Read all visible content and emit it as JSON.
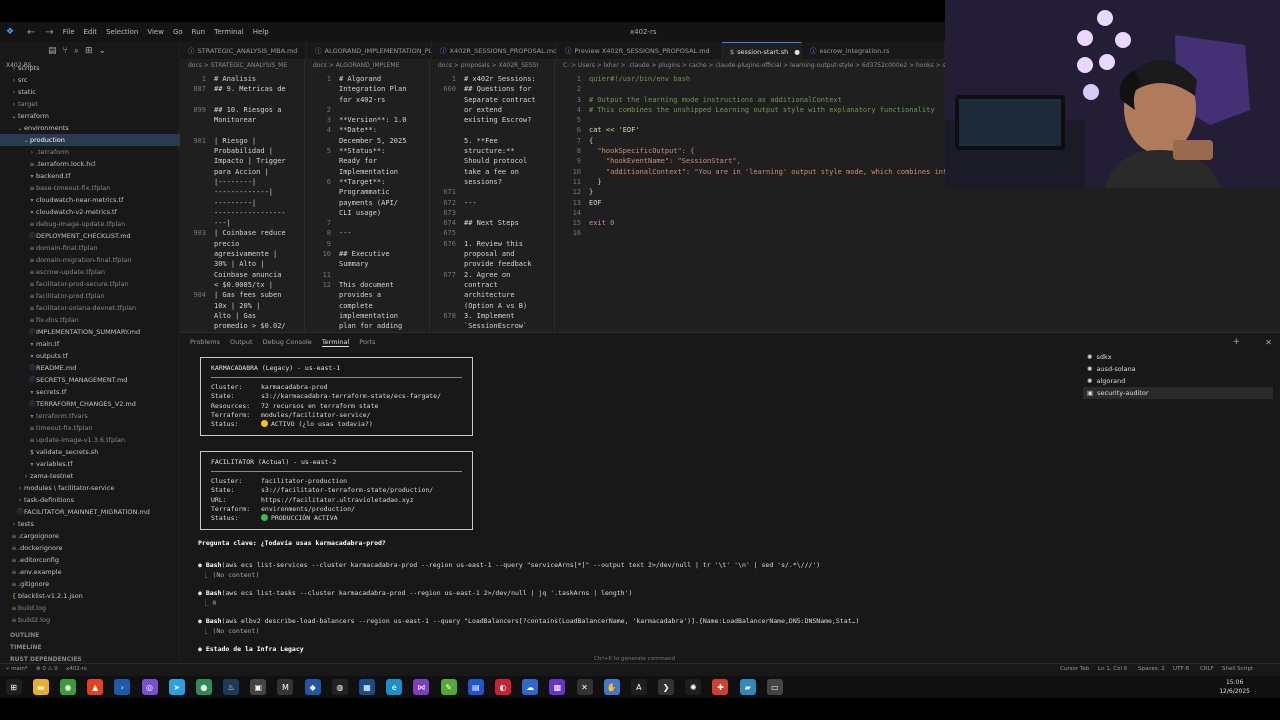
{
  "window": {
    "title": "x402-rs",
    "menus": [
      "File",
      "Edit",
      "Selection",
      "View",
      "Go",
      "Run",
      "Terminal",
      "Help"
    ]
  },
  "explorer": {
    "root": "X402-RS",
    "items": [
      {
        "label": "scripts",
        "depth": 1,
        "kind": "folder",
        "color": "#c5c5c5"
      },
      {
        "label": "src",
        "depth": 1,
        "kind": "folder",
        "color": "#c5c5c5"
      },
      {
        "label": "static",
        "depth": 1,
        "kind": "folder",
        "color": "#c5c5c5"
      },
      {
        "label": "target",
        "depth": 1,
        "kind": "folder",
        "color": "#8a8a8a"
      },
      {
        "label": "terraform",
        "depth": 1,
        "kind": "folder-open",
        "color": "#c5c5c5"
      },
      {
        "label": "environments",
        "depth": 2,
        "kind": "folder-open",
        "color": "#c5c5c5"
      },
      {
        "label": "production",
        "depth": 3,
        "kind": "folder-open",
        "color": "#ffffff",
        "selected": true
      },
      {
        "label": ".terraform",
        "depth": 4,
        "kind": "folder",
        "color": "#8a8a8a"
      },
      {
        "label": ".terraform.lock.hcl",
        "depth": 4,
        "kind": "file",
        "color": "#c5c5c5"
      },
      {
        "label": "backend.tf",
        "depth": 4,
        "kind": "tf",
        "color": "#c5c5c5"
      },
      {
        "label": "base-timeout-fix.tfplan",
        "depth": 4,
        "kind": "file",
        "color": "#8a8a8a"
      },
      {
        "label": "cloudwatch-near-metrics.tf",
        "depth": 4,
        "kind": "tf",
        "color": "#c5c5c5"
      },
      {
        "label": "cloudwatch-v2-metrics.tf",
        "depth": 4,
        "kind": "tf",
        "color": "#c5c5c5"
      },
      {
        "label": "debug-image-update.tfplan",
        "depth": 4,
        "kind": "file",
        "color": "#8a8a8a"
      },
      {
        "label": "DEPLOYMENT_CHECKLIST.md",
        "depth": 4,
        "kind": "md",
        "color": "#c5c5c5"
      },
      {
        "label": "domain-final.tfplan",
        "depth": 4,
        "kind": "file",
        "color": "#8a8a8a"
      },
      {
        "label": "domain-migration-final.tfplan",
        "depth": 4,
        "kind": "file",
        "color": "#8a8a8a"
      },
      {
        "label": "escrow-update.tfplan",
        "depth": 4,
        "kind": "file",
        "color": "#8a8a8a"
      },
      {
        "label": "facilitator-prod-secure.tfplan",
        "depth": 4,
        "kind": "file",
        "color": "#8a8a8a"
      },
      {
        "label": "facilitator-prod.tfplan",
        "depth": 4,
        "kind": "file",
        "color": "#8a8a8a"
      },
      {
        "label": "facilitator-solana-devnet.tfplan",
        "depth": 4,
        "kind": "file",
        "color": "#8a8a8a"
      },
      {
        "label": "fix-dns.tfplan",
        "depth": 4,
        "kind": "file",
        "color": "#8a8a8a"
      },
      {
        "label": "IMPLEMENTATION_SUMMARY.md",
        "depth": 4,
        "kind": "md",
        "color": "#c5c5c5"
      },
      {
        "label": "main.tf",
        "depth": 4,
        "kind": "tf",
        "color": "#c5c5c5"
      },
      {
        "label": "outputs.tf",
        "depth": 4,
        "kind": "tf",
        "color": "#c5c5c5"
      },
      {
        "label": "README.md",
        "depth": 4,
        "kind": "md",
        "color": "#c5c5c5"
      },
      {
        "label": "SECRETS_MANAGEMENT.md",
        "depth": 4,
        "kind": "md",
        "color": "#c5c5c5"
      },
      {
        "label": "secrets.tf",
        "depth": 4,
        "kind": "tf",
        "color": "#c5c5c5"
      },
      {
        "label": "TERRAFORM_CHANGES_V2.md",
        "depth": 4,
        "kind": "md",
        "color": "#c5c5c5"
      },
      {
        "label": "terraform.tfvars",
        "depth": 4,
        "kind": "tf",
        "color": "#8a8a8a"
      },
      {
        "label": "timeout-fix.tfplan",
        "depth": 4,
        "kind": "file",
        "color": "#8a8a8a"
      },
      {
        "label": "update-image-v1.3.6.tfplan",
        "depth": 4,
        "kind": "file",
        "color": "#8a8a8a"
      },
      {
        "label": "validate_secrets.sh",
        "depth": 4,
        "kind": "sh",
        "color": "#c5c5c5"
      },
      {
        "label": "variables.tf",
        "depth": 4,
        "kind": "tf",
        "color": "#c5c5c5"
      },
      {
        "label": "zama-testnet",
        "depth": 3,
        "kind": "folder",
        "color": "#c5c5c5"
      },
      {
        "label": "modules \\ facilitator-service",
        "depth": 2,
        "kind": "folder",
        "color": "#c5c5c5"
      },
      {
        "label": "task-definitions",
        "depth": 2,
        "kind": "folder",
        "color": "#c5c5c5"
      },
      {
        "label": "FACILITATOR_MAINNET_MIGRATION.md",
        "depth": 2,
        "kind": "md",
        "color": "#c5c5c5"
      },
      {
        "label": "tests",
        "depth": 1,
        "kind": "folder",
        "color": "#c5c5c5"
      },
      {
        "label": ".cargoignore",
        "depth": 1,
        "kind": "file",
        "color": "#c5c5c5"
      },
      {
        "label": ".dockerignore",
        "depth": 1,
        "kind": "file",
        "color": "#c5c5c5"
      },
      {
        "label": ".editorconfig",
        "depth": 1,
        "kind": "file",
        "color": "#c5c5c5"
      },
      {
        "label": ".env.example",
        "depth": 1,
        "kind": "file",
        "color": "#c5c5c5"
      },
      {
        "label": ".gitignore",
        "depth": 1,
        "kind": "file",
        "color": "#c5c5c5"
      },
      {
        "label": "blacklist-v1.2.1.json",
        "depth": 1,
        "kind": "json",
        "color": "#c5c5c5"
      },
      {
        "label": "build.log",
        "depth": 1,
        "kind": "file",
        "color": "#8a8a8a"
      },
      {
        "label": "build2.log",
        "depth": 1,
        "kind": "file",
        "color": "#8a8a8a"
      }
    ],
    "sections": [
      "OUTLINE",
      "TIMELINE",
      "RUST DEPENDENCIES"
    ]
  },
  "tabs": [
    {
      "label": "STRATEGIC_ANALYSIS_MBA.md",
      "w": 127
    },
    {
      "label": "ALGORAND_IMPLEMENTATION_PLAN.md",
      "w": 125
    },
    {
      "label": "X402R_SESSIONS_PROPOSAL.md",
      "w": 125
    },
    {
      "label": "Preview X402R_SESSIONS_PROPOSAL.md",
      "w": 165
    },
    {
      "label": "session-start.sh",
      "w": 80,
      "active": true
    },
    {
      "label": "escrow_integration.rs",
      "w": 143
    }
  ],
  "panes": [
    {
      "crumb": "docs > STRATEGIC_ANALYSIS_ME",
      "lines": [
        {
          "n": "1",
          "t": "# Analisis"
        },
        {
          "n": "887",
          "t": "## 9. Metricas de"
        },
        {
          "n": "",
          "t": ""
        },
        {
          "n": "899",
          "t": "## 10. Riesgos a"
        },
        {
          "n": "",
          "t": "Monitorear"
        },
        {
          "n": "",
          "t": ""
        },
        {
          "n": "901",
          "t": "| Riesgo |"
        },
        {
          "n": "",
          "t": "Probabilidad |"
        },
        {
          "n": "",
          "t": "Impacto | Trigger"
        },
        {
          "n": "",
          "t": "para Accion |"
        },
        {
          "n": "",
          "t": "|--------|"
        },
        {
          "n": "",
          "t": "-------------|"
        },
        {
          "n": "",
          "t": "---------|"
        },
        {
          "n": "",
          "t": "-----------------"
        },
        {
          "n": "",
          "t": "---|"
        },
        {
          "n": "903",
          "t": "| Coinbase reduce"
        },
        {
          "n": "",
          "t": "precio"
        },
        {
          "n": "",
          "t": "agresivamente |"
        },
        {
          "n": "",
          "t": "30% | Alto |"
        },
        {
          "n": "",
          "t": "Coinbase anuncia"
        },
        {
          "n": "",
          "t": "< $0.0005/tx |"
        },
        {
          "n": "904",
          "t": "| Gas fees suben"
        },
        {
          "n": "",
          "t": "10x | 20% |"
        },
        {
          "n": "",
          "t": "Alto | Gas"
        },
        {
          "n": "",
          "t": "promedio > $0.02/"
        }
      ]
    },
    {
      "crumb": "docs > ALGORAND_IMPLEME",
      "lines": [
        {
          "n": "1",
          "t": "# Algorand"
        },
        {
          "n": "",
          "t": "Integration Plan"
        },
        {
          "n": "",
          "t": "for x402-rs"
        },
        {
          "n": "2",
          "t": ""
        },
        {
          "n": "3",
          "t": "**Version**: 1.0"
        },
        {
          "n": "4",
          "t": "**Date**:"
        },
        {
          "n": "",
          "t": "December 5, 2025"
        },
        {
          "n": "5",
          "t": "**Status**:"
        },
        {
          "n": "",
          "t": "Ready for"
        },
        {
          "n": "",
          "t": "Implementation"
        },
        {
          "n": "6",
          "t": "**Target**:"
        },
        {
          "n": "",
          "t": "Programmatic"
        },
        {
          "n": "",
          "t": "payments (API/"
        },
        {
          "n": "",
          "t": "CLI usage)"
        },
        {
          "n": "7",
          "t": ""
        },
        {
          "n": "8",
          "t": "---"
        },
        {
          "n": "9",
          "t": ""
        },
        {
          "n": "10",
          "t": "## Executive"
        },
        {
          "n": "",
          "t": "Summary"
        },
        {
          "n": "11",
          "t": ""
        },
        {
          "n": "12",
          "t": "This document"
        },
        {
          "n": "",
          "t": "provides a"
        },
        {
          "n": "",
          "t": "complete"
        },
        {
          "n": "",
          "t": "implementation"
        },
        {
          "n": "",
          "t": "plan for adding"
        }
      ]
    },
    {
      "crumb": "docs > proposals > X402R_SESSI",
      "lines": [
        {
          "n": "1",
          "t": "# x402r Sessions:"
        },
        {
          "n": "660",
          "t": "## Questions for"
        },
        {
          "n": "",
          "t": "Separate contract"
        },
        {
          "n": "",
          "t": "or extend"
        },
        {
          "n": "",
          "t": "existing Escrow?"
        },
        {
          "n": "",
          "t": ""
        },
        {
          "n": "",
          "t": "5. **Fee"
        },
        {
          "n": "",
          "t": "structure:**"
        },
        {
          "n": "",
          "t": "Should protocol"
        },
        {
          "n": "",
          "t": "take a fee on"
        },
        {
          "n": "",
          "t": "sessions?"
        },
        {
          "n": "671",
          "t": ""
        },
        {
          "n": "672",
          "t": "---"
        },
        {
          "n": "673",
          "t": ""
        },
        {
          "n": "674",
          "t": "## Next Steps"
        },
        {
          "n": "675",
          "t": ""
        },
        {
          "n": "676",
          "t": "1. Review this"
        },
        {
          "n": "",
          "t": "proposal and"
        },
        {
          "n": "",
          "t": "provide feedback"
        },
        {
          "n": "677",
          "t": "2. Agree on"
        },
        {
          "n": "",
          "t": "contract"
        },
        {
          "n": "",
          "t": "architecture"
        },
        {
          "n": "",
          "t": "(Option A vs B)"
        },
        {
          "n": "678",
          "t": "3. Implement"
        },
        {
          "n": "",
          "t": "`SessionEscrow`"
        }
      ]
    },
    {
      "crumb": "C: > Users > lxhxr > .claude > plugins > cache > claude-plugins-official > learning-output-style > 6d3752c000e2 > hooks > session-start.sh",
      "lines": [
        {
          "n": "1",
          "t": "quier#!/usr/bin/env bash",
          "c": "cm"
        },
        {
          "n": "2",
          "t": ""
        },
        {
          "n": "3",
          "t": "# Output the learning mode instructions as additionalContext",
          "c": "cm"
        },
        {
          "n": "4",
          "t": "# This combines the unshipped Learning output style with explanatory functionality",
          "c": "cm"
        },
        {
          "n": "5",
          "t": ""
        },
        {
          "n": "6",
          "t": "cat << 'EOF'",
          "c": "fn"
        },
        {
          "n": "7",
          "t": "{",
          "c": "t"
        },
        {
          "n": "8",
          "t": "  \"hookSpecificOutput\": {",
          "c": "st"
        },
        {
          "n": "9",
          "t": "    \"hookEventName\": \"SessionStart\",",
          "c": "st"
        },
        {
          "n": "10",
          "t": "    \"additionalContext\": \"You are in 'learning' output style mode, which combines interactive",
          "c": "st"
        },
        {
          "n": "11",
          "t": "  }",
          "c": "t"
        },
        {
          "n": "12",
          "t": "}",
          "c": "t"
        },
        {
          "n": "13",
          "t": "EOF",
          "c": "t"
        },
        {
          "n": "14",
          "t": ""
        },
        {
          "n": "15",
          "t": "exit 0",
          "c": "kw"
        },
        {
          "n": "16",
          "t": ""
        }
      ]
    }
  ],
  "panel": {
    "tabs": [
      "Problems",
      "Output",
      "Debug Console",
      "Terminal",
      "Ports"
    ],
    "active_tab": "Terminal"
  },
  "terminal": {
    "box1": {
      "title": "KARMACADABRA (Legacy) - us-east-1",
      "rows": [
        {
          "k": "Cluster:",
          "v": "karmacadabra-prod"
        },
        {
          "k": "State:",
          "v": "s3://karmacadabra-terraform-state/ecs-fargate/"
        },
        {
          "k": "Resources:",
          "v": "72 recursos en terraform state"
        },
        {
          "k": "Terraform:",
          "v": "modules/facilitator-service/"
        },
        {
          "k": "Status:",
          "v": "ACTIVO (¿lo usas todavia?)",
          "dot": "#f2c811"
        }
      ]
    },
    "box2": {
      "title": "FACILITATOR (Actual) - us-east-2",
      "rows": [
        {
          "k": "Cluster:",
          "v": "facilitator-production"
        },
        {
          "k": "State:",
          "v": "s3://facilitator-terraform-state/production/"
        },
        {
          "k": "URL:",
          "v": "https://facilitator.ultravioletadao.xyz"
        },
        {
          "k": "Terraform:",
          "v": "environments/production/"
        },
        {
          "k": "Status:",
          "v": "PRODUCCIÓN ACTIVA",
          "dot": "#3fb950"
        }
      ]
    },
    "question": "Pregunta clave: ¿Todavía usas karmacadabra-prod?",
    "cmds": [
      {
        "tool": "Bash",
        "cmd": "(aws ecs list-services --cluster karmacadabra-prod --region us-east-1 --query \"serviceArns[*]\" --output text 2>/dev/null | tr '\\t' '\\n' | sed 's/.*\\///')",
        "out": "(No content)"
      },
      {
        "tool": "Bash",
        "cmd": "(aws ecs list-tasks --cluster karmacadabra-prod --region us-east-1 2>/dev/null | jq '.taskArns | length')",
        "out": "0"
      },
      {
        "tool": "Bash",
        "cmd": "(aws elbv2 describe-load-balancers --region us-east-1 --query \"LoadBalancers[?contains(LoadBalancerName, 'karmacadabra')].{Name:LoadBalancerName,DNS:DNSName,Stat…)",
        "out": "(No content)"
      }
    ],
    "last": "Estado de la Infra Legacy",
    "hint": "Ctrl+K to generate command"
  },
  "processes": [
    {
      "label": "sdkx"
    },
    {
      "label": "ausd-solana"
    },
    {
      "label": "algorand"
    },
    {
      "label": "security-auditor",
      "selected": true
    }
  ],
  "statusbar": {
    "branch": "main*",
    "errors": "⊗ 0 ⚠ 0",
    "workspace": "x402-rs",
    "right": [
      "Cursor Tab",
      "Ln 1, Col 6",
      "Spaces: 2",
      "UTF-8",
      "CRLF",
      "Shell Script"
    ]
  },
  "clock": {
    "time": "15:06",
    "date": "12/6/2025"
  },
  "taskbar": {
    "icons": [
      {
        "name": "windows-start-icon",
        "c": "#1e1e1e",
        "g": "⊞"
      },
      {
        "name": "file-explorer-icon",
        "c": "#e8b02a",
        "g": "▬"
      },
      {
        "name": "app-green-icon",
        "c": "#3c9a3c",
        "g": "◉"
      },
      {
        "name": "brave-icon",
        "c": "#e0431e",
        "g": "▲"
      },
      {
        "name": "terminal-icon",
        "c": "#1e5aa8",
        "g": "›"
      },
      {
        "name": "browser-icon",
        "c": "#7a4fd1",
        "g": "◎"
      },
      {
        "name": "telegram-icon",
        "c": "#2aa1e0",
        "g": "➤"
      },
      {
        "name": "chrome-icon",
        "c": "#2e8b57",
        "g": "●"
      },
      {
        "name": "steam-icon",
        "c": "#1b3a5c",
        "g": "♨"
      },
      {
        "name": "app-icon",
        "c": "#444",
        "g": "▣"
      },
      {
        "name": "app-m-icon",
        "c": "#333",
        "g": "M"
      },
      {
        "name": "app-blue-icon",
        "c": "#2255aa",
        "g": "◆"
      },
      {
        "name": "obs-icon",
        "c": "#222",
        "g": "◍"
      },
      {
        "name": "app-dark-icon",
        "c": "#1a4c8c",
        "g": "▦"
      },
      {
        "name": "edge-icon",
        "c": "#1a8fc9",
        "g": "e"
      },
      {
        "name": "vscode-icon",
        "c": "#7b3fc4",
        "g": "⋈"
      },
      {
        "name": "app-pen-icon",
        "c": "#55aa33",
        "g": "✎"
      },
      {
        "name": "app-grid-icon",
        "c": "#2255cc",
        "g": "▤"
      },
      {
        "name": "app-red-icon",
        "c": "#cc2233",
        "g": "◐"
      },
      {
        "name": "app-cloud-icon",
        "c": "#3366cc",
        "g": "☁"
      },
      {
        "name": "app-purple-icon",
        "c": "#6633cc",
        "g": "▩"
      },
      {
        "name": "app-x-icon",
        "c": "#333",
        "g": "✕"
      },
      {
        "name": "app-hand-icon",
        "c": "#4477cc",
        "g": "✋"
      },
      {
        "name": "app-a-icon",
        "c": "#1e1e1e",
        "g": "A"
      },
      {
        "name": "cursor-icon",
        "c": "#333",
        "g": "❯"
      },
      {
        "name": "chatgpt-icon",
        "c": "#1e1e1e",
        "g": "✺"
      },
      {
        "name": "app-cross-icon",
        "c": "#d04030",
        "g": "✚"
      },
      {
        "name": "app-pad-icon",
        "c": "#3388bb",
        "g": "▰"
      },
      {
        "name": "app-win-icon",
        "c": "#444",
        "g": "▭"
      }
    ]
  }
}
